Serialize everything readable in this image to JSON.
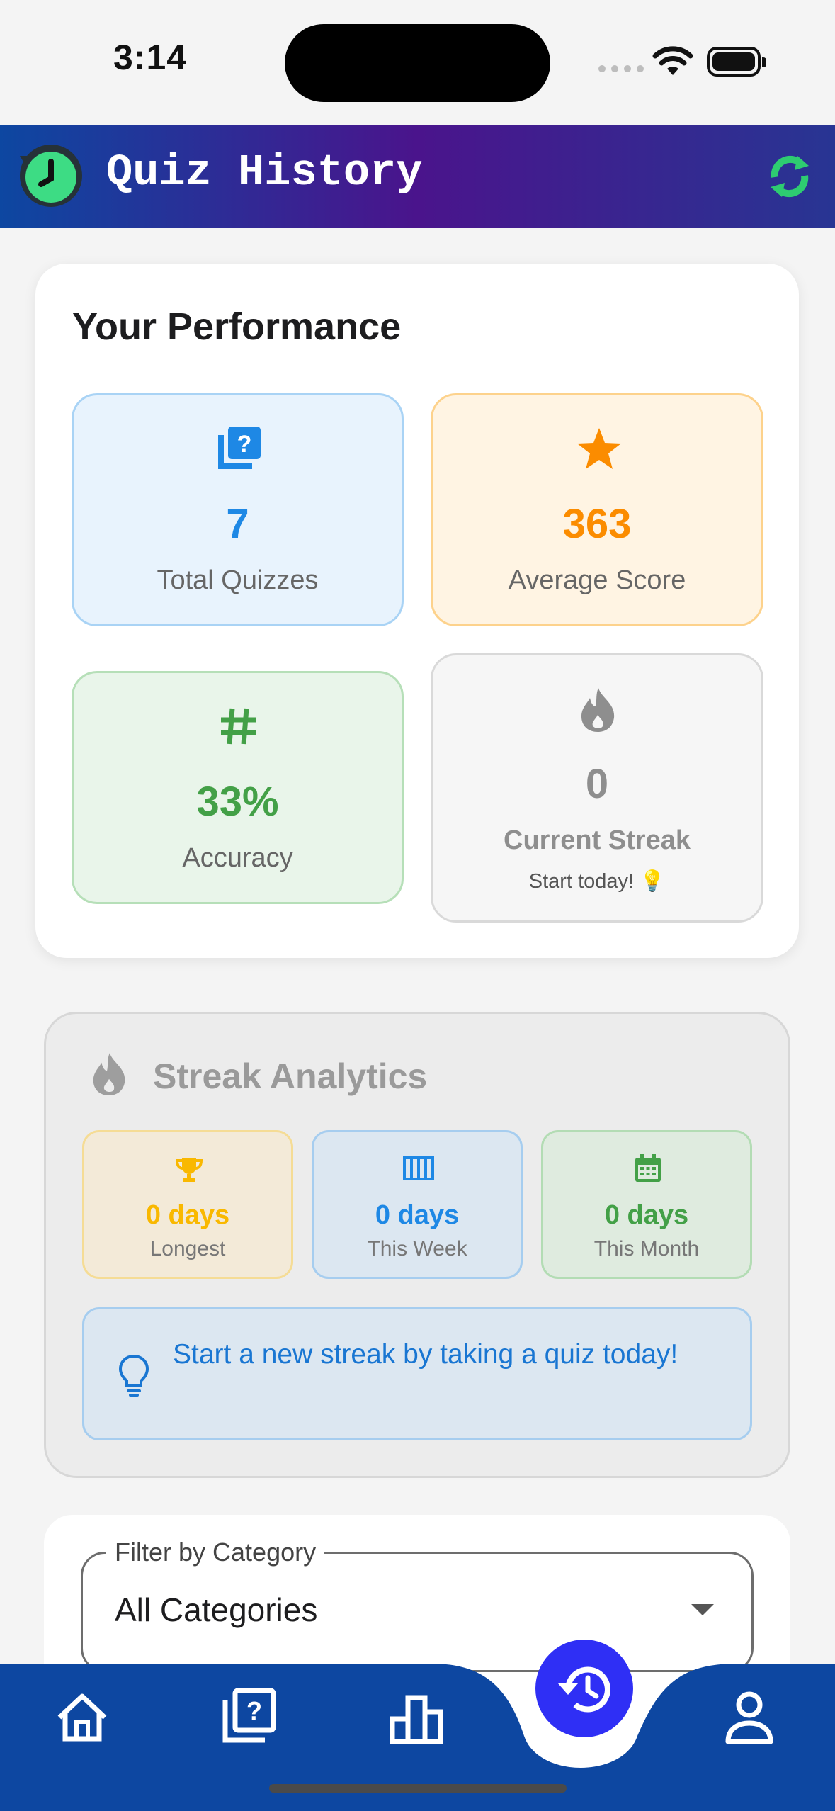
{
  "status": {
    "time": "3:14"
  },
  "header": {
    "title": "Quiz History"
  },
  "performance": {
    "title": "Your Performance",
    "stats": [
      {
        "value": "7",
        "label": "Total Quizzes"
      },
      {
        "value": "363",
        "label": "Average Score"
      },
      {
        "value": "33%",
        "label": "Accuracy"
      },
      {
        "value": "0",
        "label": "Current Streak",
        "sub": "Start today! 💡"
      }
    ]
  },
  "streak": {
    "title": "Streak Analytics",
    "items": [
      {
        "value": "0 days",
        "label": "Longest"
      },
      {
        "value": "0 days",
        "label": "This Week"
      },
      {
        "value": "0 days",
        "label": "This Month"
      }
    ],
    "tip": "Start a new streak by taking a quiz today!"
  },
  "filter": {
    "label": "Filter by Category",
    "value": "All Categories"
  },
  "colors": {
    "blue": "#1e88e5",
    "orange": "#fb8c00",
    "green": "#43a047",
    "gray": "#8e8e8e",
    "nav": "#0d47a1",
    "fab": "#2f2ff5"
  },
  "nav": {
    "icons": [
      "home-icon",
      "quiz-icon",
      "leaderboard-icon",
      "history-icon",
      "profile-icon"
    ],
    "active": "history-icon"
  }
}
